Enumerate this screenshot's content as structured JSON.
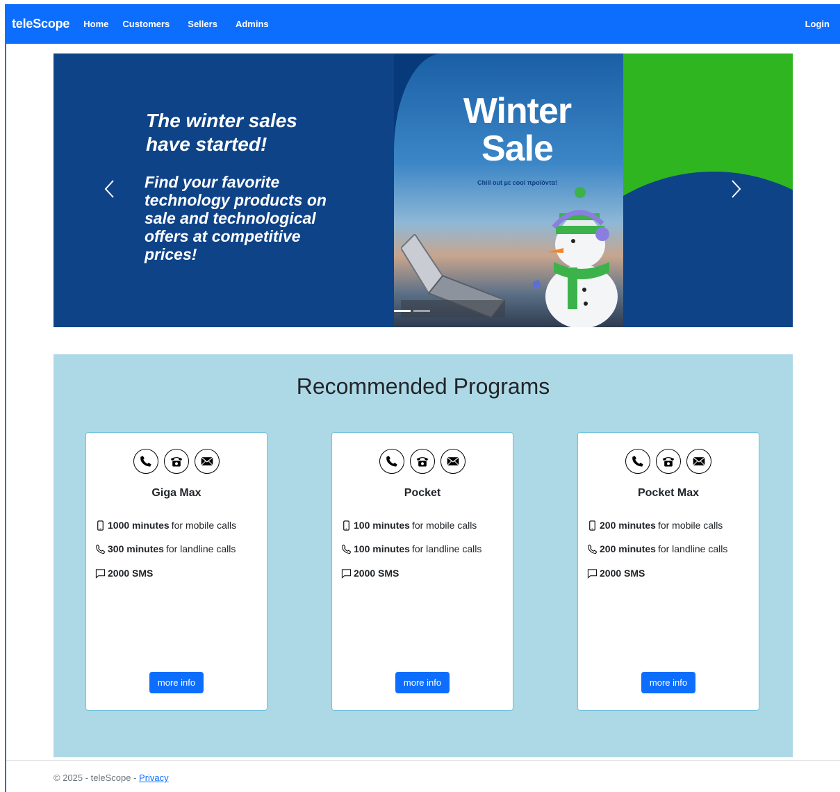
{
  "navbar": {
    "brand": "teleScope",
    "links": [
      "Home",
      "Customers",
      "Sellers",
      "Admins"
    ],
    "login": "Login"
  },
  "carousel": {
    "heading": "The winter sales have started!",
    "text": "Find your favorite technology products on sale and technological offers at competitive prices!",
    "promo_title_line1": "Winter",
    "promo_title_line2": "Sale",
    "promo_subtitle": "Chill out με cool προϊόντα!",
    "prev_icon": "chevron-left-icon",
    "next_icon": "chevron-right-icon",
    "colors": {
      "navy": "#0e4388",
      "green": "#2eb520"
    }
  },
  "recommended": {
    "title": "Recommended Programs",
    "background": "#add8e6",
    "cards": [
      {
        "name": "Giga Max",
        "mobile_minutes": "1000 minutes",
        "mobile_label": "for mobile calls",
        "landline_minutes": "300 minutes",
        "landline_label": "for landline calls",
        "sms": "2000 SMS",
        "button": "more info"
      },
      {
        "name": "Pocket",
        "mobile_minutes": "100 minutes",
        "mobile_label": "for mobile calls",
        "landline_minutes": "100 minutes",
        "landline_label": "for landline calls",
        "sms": "2000 SMS",
        "button": "more info"
      },
      {
        "name": "Pocket Max",
        "mobile_minutes": "200 minutes",
        "mobile_label": "for mobile calls",
        "landline_minutes": "200 minutes",
        "landline_label": "for landline calls",
        "sms": "2000 SMS",
        "button": "more info"
      }
    ],
    "icons": [
      "phone-icon",
      "telephone-icon",
      "envelope-icon"
    ]
  },
  "footer": {
    "copyright": "© 2025 - teleScope - ",
    "privacy": "Privacy"
  },
  "accent": "#0d6efd"
}
